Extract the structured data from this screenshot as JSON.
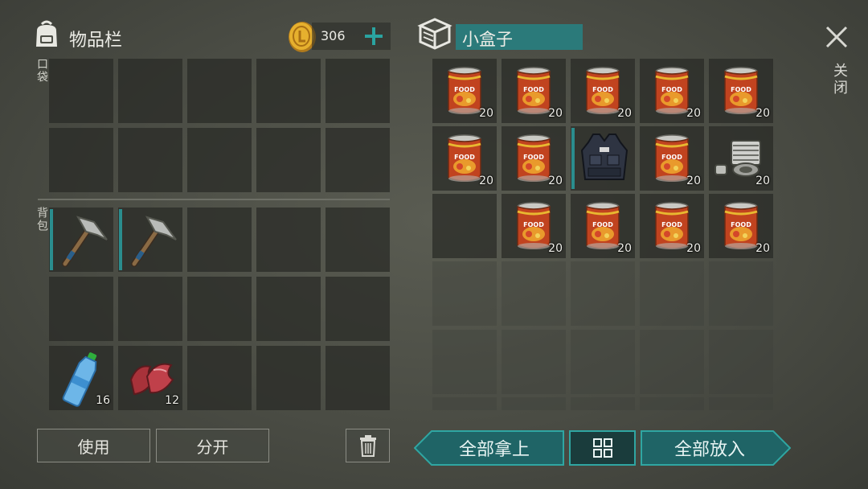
{
  "inventory": {
    "title": "物品栏",
    "backpack_icon": "backpack-icon",
    "coins": "306",
    "coin_icon": "gold-coin-icon",
    "add_coins_icon": "plus-icon",
    "pocket_label": "口袋",
    "backpack_label": "背包",
    "items": [
      {
        "slot": "backpack-1",
        "name": "pickaxe",
        "equipped": true
      },
      {
        "slot": "backpack-2",
        "name": "pickaxe",
        "equipped": true
      },
      {
        "slot": "backpack-11",
        "name": "water-bottle",
        "count": "16"
      },
      {
        "slot": "backpack-12",
        "name": "raw-meat",
        "count": "12"
      }
    ]
  },
  "container": {
    "icon": "box-icon",
    "name": "小盒子",
    "items": [
      {
        "name": "food-can",
        "count": "20"
      },
      {
        "name": "food-can",
        "count": "20"
      },
      {
        "name": "food-can",
        "count": "20"
      },
      {
        "name": "food-can",
        "count": "20"
      },
      {
        "name": "food-can",
        "count": "20"
      },
      {
        "name": "food-can",
        "count": "20"
      },
      {
        "name": "food-can",
        "count": "20"
      },
      {
        "name": "police-vest",
        "equipped": true
      },
      {
        "name": "food-can",
        "count": "20"
      },
      {
        "name": "engine-cylinder",
        "count": "20"
      },
      {
        "name": "empty"
      },
      {
        "name": "food-can",
        "count": "20"
      },
      {
        "name": "food-can",
        "count": "20"
      },
      {
        "name": "food-can",
        "count": "20"
      },
      {
        "name": "food-can",
        "count": "20"
      }
    ],
    "can_label": "FOOD"
  },
  "actions": {
    "use": "使用",
    "split": "分开",
    "trash_icon": "trash-icon",
    "take_all": "全部拿上",
    "sort_icon": "grid-sort-icon",
    "put_all": "全部放入"
  },
  "close": {
    "icon": "close-icon",
    "label": "关闭"
  },
  "colors": {
    "accent": "#2a8d8e",
    "accent_dark": "#1f6466",
    "slot": "#2a2c28"
  }
}
